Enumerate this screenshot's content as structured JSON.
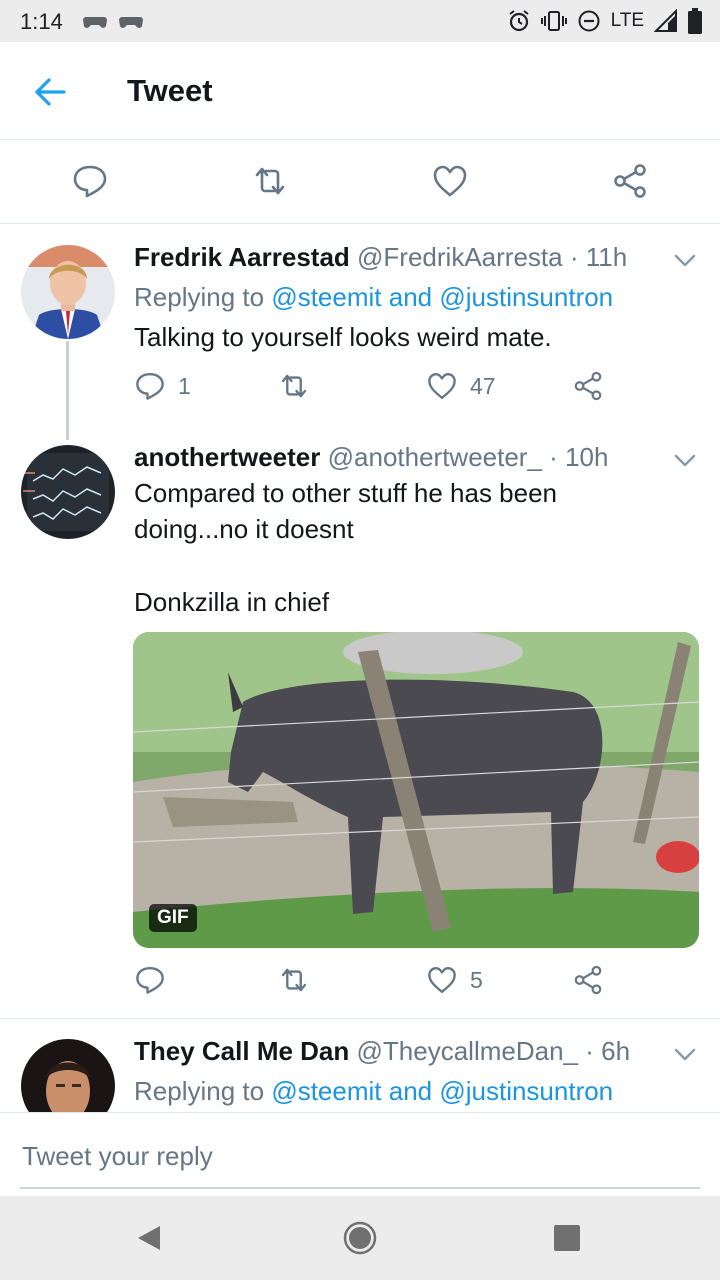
{
  "status_bar": {
    "time": "1:14",
    "network": "LTE"
  },
  "header": {
    "title": "Tweet"
  },
  "tweets": [
    {
      "name": "Fredrik Aarrestad",
      "handle": "@FredrikAarresta",
      "time": " · 11h",
      "replying_prefix": "Replying to ",
      "replying_to": "@steemit and @justinsuntron",
      "text": "Talking to yourself looks weird mate.",
      "reply_count": "1",
      "retweet_count": "",
      "like_count": "47"
    },
    {
      "name": "anothertweeter",
      "handle": "@anothertweeter_",
      "time": " · 10h",
      "text_line1": "Compared to other stuff he has been",
      "text_line2": "doing...no it doesnt",
      "text_line3": "Donkzilla in chief",
      "media_badge": "GIF",
      "reply_count": "",
      "retweet_count": "",
      "like_count": "5"
    },
    {
      "name": "They Call Me Dan",
      "handle": "@TheycallmeDan_",
      "time": " · 6h",
      "replying_prefix": "Replying to ",
      "replying_to": "@steemit and @justinsuntron"
    }
  ],
  "reply_input": {
    "placeholder": "Tweet your reply"
  },
  "colors": {
    "accent": "#1da1f2",
    "link": "#1b95e0",
    "secondary_text": "#657786"
  },
  "icons": [
    "back-arrow-icon",
    "reply-icon",
    "retweet-icon",
    "like-icon",
    "share-icon",
    "chevron-down-icon",
    "alarm-icon",
    "vibrate-icon",
    "dnd-icon",
    "signal-icon",
    "battery-icon"
  ]
}
